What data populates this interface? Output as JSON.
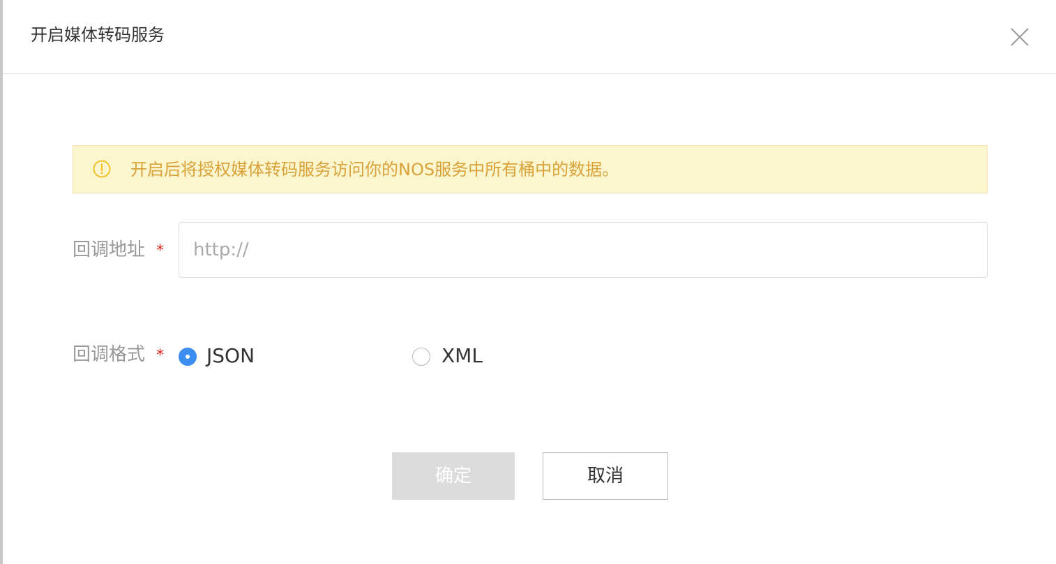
{
  "dialog": {
    "title": "开启媒体转码服务",
    "close_icon": "close-icon"
  },
  "alert": {
    "icon": "warning-circle-icon",
    "text": "开启后将授权媒体转码服务访问你的NOS服务中所有桶中的数据。",
    "color": "#d9a23a",
    "background": "#fbf6cd"
  },
  "form": {
    "callback_url": {
      "label": "回调地址",
      "required_mark": "*",
      "value": "",
      "placeholder": "http://"
    },
    "callback_format": {
      "label": "回调格式",
      "required_mark": "*",
      "options": [
        {
          "label": "JSON",
          "selected": true
        },
        {
          "label": "XML",
          "selected": false
        }
      ]
    }
  },
  "actions": {
    "confirm_label": "确定",
    "cancel_label": "取消"
  },
  "colors": {
    "accent": "#3c8ef0",
    "required": "#e02020"
  }
}
